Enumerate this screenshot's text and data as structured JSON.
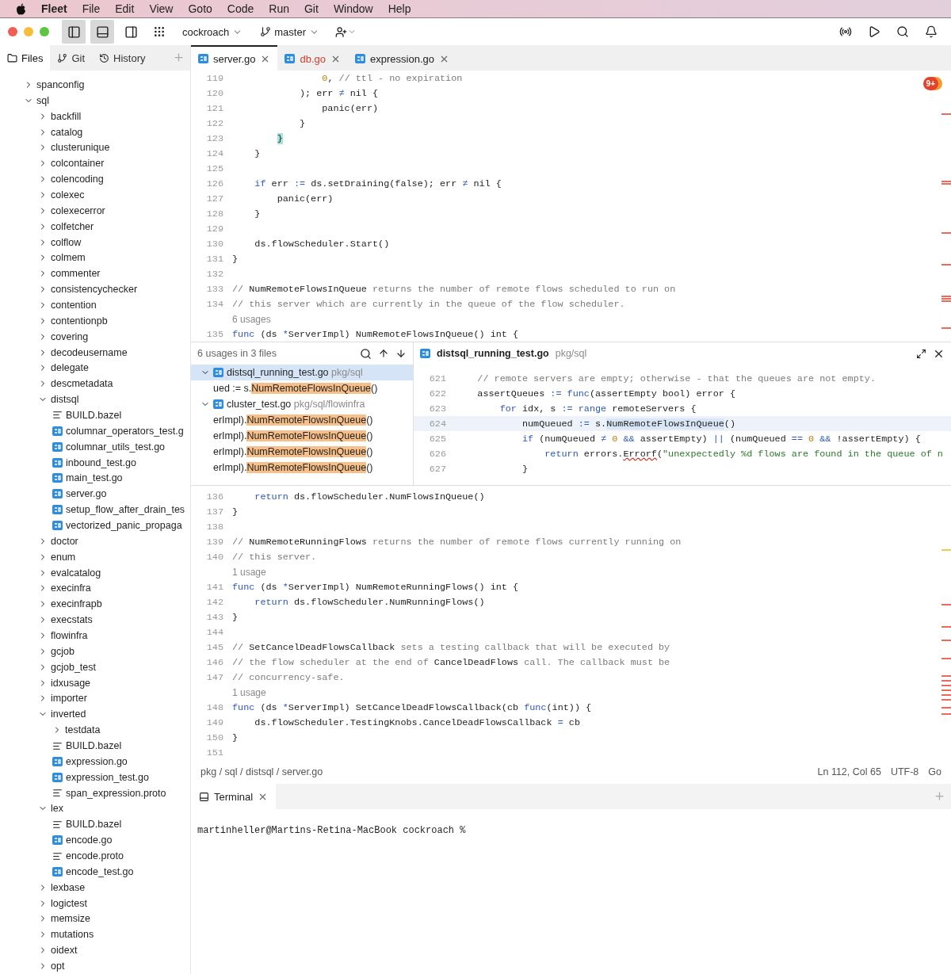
{
  "menu_bar": {
    "app": "Fleet",
    "items": [
      "File",
      "Edit",
      "View",
      "Goto",
      "Code",
      "Run",
      "Git",
      "Window",
      "Help"
    ]
  },
  "toolbar": {
    "panel_toggles": [
      {
        "selected": true
      },
      {
        "selected": true
      },
      {
        "selected": false
      }
    ],
    "workspace": "cockroach",
    "branch": "master"
  },
  "sidebar": {
    "tabs": [
      {
        "label": "Files",
        "selected": true
      },
      {
        "label": "Git",
        "selected": false
      },
      {
        "label": "History",
        "selected": false
      }
    ],
    "tree": [
      {
        "name": "spanconfig",
        "kind": "folder",
        "expanded": false
      },
      {
        "name": "sql",
        "kind": "folder",
        "expanded": true,
        "children": [
          {
            "name": "backfill",
            "kind": "folder",
            "expanded": false
          },
          {
            "name": "catalog",
            "kind": "folder",
            "expanded": false
          },
          {
            "name": "clusterunique",
            "kind": "folder",
            "expanded": false
          },
          {
            "name": "colcontainer",
            "kind": "folder",
            "expanded": false
          },
          {
            "name": "colencoding",
            "kind": "folder",
            "expanded": false
          },
          {
            "name": "colexec",
            "kind": "folder",
            "expanded": false
          },
          {
            "name": "colexecerror",
            "kind": "folder",
            "expanded": false
          },
          {
            "name": "colfetcher",
            "kind": "folder",
            "expanded": false
          },
          {
            "name": "colflow",
            "kind": "folder",
            "expanded": false
          },
          {
            "name": "colmem",
            "kind": "folder",
            "expanded": false
          },
          {
            "name": "commenter",
            "kind": "folder",
            "expanded": false
          },
          {
            "name": "consistencychecker",
            "kind": "folder",
            "expanded": false
          },
          {
            "name": "contention",
            "kind": "folder",
            "expanded": false
          },
          {
            "name": "contentionpb",
            "kind": "folder",
            "expanded": false
          },
          {
            "name": "covering",
            "kind": "folder",
            "expanded": false
          },
          {
            "name": "decodeusername",
            "kind": "folder",
            "expanded": false
          },
          {
            "name": "delegate",
            "kind": "folder",
            "expanded": false
          },
          {
            "name": "descmetadata",
            "kind": "folder",
            "expanded": false
          },
          {
            "name": "distsql",
            "kind": "folder",
            "expanded": true,
            "children": [
              {
                "name": "BUILD.bazel",
                "kind": "text"
              },
              {
                "name": "columnar_operators_test.g",
                "kind": "go"
              },
              {
                "name": "columnar_utils_test.go",
                "kind": "go"
              },
              {
                "name": "inbound_test.go",
                "kind": "go"
              },
              {
                "name": "main_test.go",
                "kind": "go"
              },
              {
                "name": "server.go",
                "kind": "go"
              },
              {
                "name": "setup_flow_after_drain_tes",
                "kind": "go"
              },
              {
                "name": "vectorized_panic_propaga",
                "kind": "go"
              }
            ]
          },
          {
            "name": "doctor",
            "kind": "folder",
            "expanded": false
          },
          {
            "name": "enum",
            "kind": "folder",
            "expanded": false
          },
          {
            "name": "evalcatalog",
            "kind": "folder",
            "expanded": false
          },
          {
            "name": "execinfra",
            "kind": "folder",
            "expanded": false
          },
          {
            "name": "execinfrapb",
            "kind": "folder",
            "expanded": false
          },
          {
            "name": "execstats",
            "kind": "folder",
            "expanded": false
          },
          {
            "name": "flowinfra",
            "kind": "folder",
            "expanded": false
          },
          {
            "name": "gcjob",
            "kind": "folder",
            "expanded": false
          },
          {
            "name": "gcjob_test",
            "kind": "folder",
            "expanded": false
          },
          {
            "name": "idxusage",
            "kind": "folder",
            "expanded": false
          },
          {
            "name": "importer",
            "kind": "folder",
            "expanded": false
          },
          {
            "name": "inverted",
            "kind": "folder",
            "expanded": true,
            "children": [
              {
                "name": "testdata",
                "kind": "folder",
                "expanded": false
              },
              {
                "name": "BUILD.bazel",
                "kind": "text"
              },
              {
                "name": "expression.go",
                "kind": "go"
              },
              {
                "name": "expression_test.go",
                "kind": "go"
              },
              {
                "name": "span_expression.proto",
                "kind": "text"
              }
            ]
          },
          {
            "name": "lex",
            "kind": "folder",
            "expanded": true,
            "children": [
              {
                "name": "BUILD.bazel",
                "kind": "text"
              },
              {
                "name": "encode.go",
                "kind": "go"
              },
              {
                "name": "encode.proto",
                "kind": "text"
              },
              {
                "name": "encode_test.go",
                "kind": "go"
              }
            ]
          },
          {
            "name": "lexbase",
            "kind": "folder",
            "expanded": false
          },
          {
            "name": "logictest",
            "kind": "folder",
            "expanded": false
          },
          {
            "name": "memsize",
            "kind": "folder",
            "expanded": false
          },
          {
            "name": "mutations",
            "kind": "folder",
            "expanded": false
          },
          {
            "name": "oidext",
            "kind": "folder",
            "expanded": false
          },
          {
            "name": "opt",
            "kind": "folder",
            "expanded": false
          }
        ]
      }
    ]
  },
  "editor_tabs": [
    {
      "name": "server.go",
      "selected": true,
      "has_errors": false
    },
    {
      "name": "db.go",
      "selected": false,
      "has_errors": true
    },
    {
      "name": "expression.go",
      "selected": false,
      "has_errors": false
    }
  ],
  "problems_badge": "9+",
  "top_pane": [
    {
      "kind": "code",
      "number": "119",
      "tokens": [
        {
          "kind": "number",
          "text": "                0"
        },
        {
          "kind": "text",
          "text": ", "
        },
        {
          "kind": "comment",
          "text": "// ttl - no expiration"
        }
      ]
    },
    {
      "kind": "code",
      "number": "120",
      "tokens": [
        {
          "kind": "text",
          "text": "            ); err "
        },
        {
          "kind": "operator",
          "text": "≠"
        },
        {
          "kind": "text",
          "text": " nil {"
        }
      ]
    },
    {
      "kind": "code",
      "number": "121",
      "tokens": [
        {
          "kind": "text",
          "text": "                panic(err)"
        }
      ]
    },
    {
      "kind": "code",
      "number": "122",
      "tokens": [
        {
          "kind": "text",
          "text": "            }"
        }
      ]
    },
    {
      "kind": "code",
      "number": "123",
      "tokens": [
        {
          "kind": "bracket_match",
          "text": "        }"
        }
      ]
    },
    {
      "kind": "code",
      "number": "124",
      "tokens": [
        {
          "kind": "text",
          "text": "    }"
        }
      ]
    },
    {
      "kind": "code",
      "number": "125"
    },
    {
      "kind": "code",
      "number": "126",
      "tokens": [
        {
          "kind": "keyword",
          "text": "    if"
        },
        {
          "kind": "text",
          "text": " err "
        },
        {
          "kind": "operator",
          "text": ":="
        },
        {
          "kind": "text",
          "text": " ds.setDraining(false); err "
        },
        {
          "kind": "operator",
          "text": "≠"
        },
        {
          "kind": "text",
          "text": " nil {"
        }
      ]
    },
    {
      "kind": "code",
      "number": "127",
      "tokens": [
        {
          "kind": "text",
          "text": "        panic(err)"
        }
      ]
    },
    {
      "kind": "code",
      "number": "128",
      "tokens": [
        {
          "kind": "text",
          "text": "    }"
        }
      ]
    },
    {
      "kind": "code",
      "number": "129"
    },
    {
      "kind": "code",
      "number": "130",
      "tokens": [
        {
          "kind": "text",
          "text": "    ds.flowScheduler.Start()"
        }
      ]
    },
    {
      "kind": "code",
      "number": "131",
      "tokens": [
        {
          "kind": "text",
          "text": "}"
        }
      ]
    },
    {
      "kind": "code",
      "number": "132"
    },
    {
      "kind": "code",
      "number": "133",
      "tokens": [
        {
          "kind": "comment",
          "text": "// "
        },
        {
          "kind": "doc_ref",
          "text": "NumRemoteFlowsInQueue"
        },
        {
          "kind": "comment",
          "text": " returns the number of remote flows scheduled to run on"
        }
      ]
    },
    {
      "kind": "code",
      "number": "134",
      "tokens": [
        {
          "kind": "comment",
          "text": "// this server which are currently in the queue of the flow scheduler."
        }
      ]
    },
    {
      "kind": "hint",
      "text": "6 usages"
    },
    {
      "kind": "code",
      "number": "135",
      "tokens": [
        {
          "kind": "keyword",
          "text": "func"
        },
        {
          "kind": "text",
          "text": " (ds "
        },
        {
          "kind": "operator",
          "text": "*"
        },
        {
          "kind": "text",
          "text": "ServerImpl) NumRemoteFlowsInQueue() int {"
        }
      ]
    }
  ],
  "usages": {
    "title": "6 usages in 3 files",
    "rows": [
      {
        "kind": "file",
        "expanded": true,
        "selected": true,
        "name": "distsql_running_test.go",
        "path": "pkg/sql"
      },
      {
        "kind": "match",
        "prefix": "ued := s.",
        "match": "NumRemoteFlowsInQueue",
        "suffix": "()"
      },
      {
        "kind": "file",
        "expanded": true,
        "selected": false,
        "name": "cluster_test.go",
        "path": "pkg/sql/flowinfra"
      },
      {
        "kind": "match",
        "prefix": "erImpl).",
        "match": "NumRemoteFlowsInQueue",
        "suffix": "()"
      },
      {
        "kind": "match",
        "prefix": "erImpl).",
        "match": "NumRemoteFlowsInQueue",
        "suffix": "()"
      },
      {
        "kind": "match",
        "prefix": "erImpl).",
        "match": "NumRemoteFlowsInQueue",
        "suffix": "()"
      },
      {
        "kind": "match",
        "prefix": "erImpl).",
        "match": "NumRemoteFlowsInQueue",
        "suffix": "()"
      }
    ],
    "preview": {
      "file": "distsql_running_test.go",
      "path": "pkg/sql",
      "lines": [
        {
          "number": "621",
          "current": false,
          "tokens": [
            {
              "kind": "comment",
              "text": "    // remote servers are empty; otherwise - that the queues are not empty."
            }
          ]
        },
        {
          "number": "622",
          "current": false,
          "tokens": [
            {
              "kind": "text",
              "text": "    assertQueues "
            },
            {
              "kind": "operator",
              "text": ":="
            },
            {
              "kind": "keyword",
              "text": " func"
            },
            {
              "kind": "text",
              "text": "(assertEmpty bool) error {"
            }
          ]
        },
        {
          "number": "623",
          "current": false,
          "tokens": [
            {
              "kind": "keyword",
              "text": "        for"
            },
            {
              "kind": "text",
              "text": " idx, s "
            },
            {
              "kind": "operator",
              "text": ":="
            },
            {
              "kind": "keyword",
              "text": " range"
            },
            {
              "kind": "text",
              "text": " remoteServers {"
            }
          ]
        },
        {
          "number": "624",
          "current": true,
          "tokens": [
            {
              "kind": "text",
              "text": "            numQueued "
            },
            {
              "kind": "operator",
              "text": ":="
            },
            {
              "kind": "text",
              "text": " s."
            },
            {
              "kind": "usage",
              "text": "NumRemoteFlowsInQueue"
            },
            {
              "kind": "text",
              "text": "()"
            }
          ]
        },
        {
          "number": "625",
          "current": false,
          "tokens": [
            {
              "kind": "keyword",
              "text": "            if"
            },
            {
              "kind": "text",
              "text": " (numQueued "
            },
            {
              "kind": "operator",
              "text": "≠"
            },
            {
              "kind": "number",
              "text": " 0"
            },
            {
              "kind": "operator",
              "text": " &&"
            },
            {
              "kind": "text",
              "text": " assertEmpty) "
            },
            {
              "kind": "operator",
              "text": "||"
            },
            {
              "kind": "text",
              "text": " (numQueued "
            },
            {
              "kind": "operator",
              "text": "=="
            },
            {
              "kind": "number",
              "text": " 0"
            },
            {
              "kind": "operator",
              "text": " &&"
            },
            {
              "kind": "text",
              "text": " !assertEmpty) {"
            }
          ]
        },
        {
          "number": "626",
          "current": false,
          "tokens": [
            {
              "kind": "keyword",
              "text": "                return"
            },
            {
              "kind": "text",
              "text": " errors."
            },
            {
              "kind": "error",
              "text": "Errorf"
            },
            {
              "kind": "text",
              "text": "("
            },
            {
              "kind": "string",
              "text": "\"unexpectedly %d flows are found in the queue of n"
            }
          ]
        },
        {
          "number": "627",
          "current": false,
          "tokens": [
            {
              "kind": "text",
              "text": "            }"
            }
          ]
        }
      ]
    }
  },
  "bottom_pane": [
    {
      "kind": "code",
      "number": "136",
      "tokens": [
        {
          "kind": "keyword",
          "text": "    return"
        },
        {
          "kind": "text",
          "text": " ds.flowScheduler.NumFlowsInQueue()"
        }
      ]
    },
    {
      "kind": "code",
      "number": "137",
      "tokens": [
        {
          "kind": "text",
          "text": "}"
        }
      ]
    },
    {
      "kind": "code",
      "number": "138"
    },
    {
      "kind": "code",
      "number": "139",
      "tokens": [
        {
          "kind": "comment",
          "text": "// "
        },
        {
          "kind": "doc_ref",
          "text": "NumRemoteRunningFlows"
        },
        {
          "kind": "comment",
          "text": " returns the number of remote flows currently running on"
        }
      ]
    },
    {
      "kind": "code",
      "number": "140",
      "tokens": [
        {
          "kind": "comment",
          "text": "// this server."
        }
      ]
    },
    {
      "kind": "hint",
      "text": "1 usage"
    },
    {
      "kind": "code",
      "number": "141",
      "tokens": [
        {
          "kind": "keyword",
          "text": "func"
        },
        {
          "kind": "text",
          "text": " (ds "
        },
        {
          "kind": "operator",
          "text": "*"
        },
        {
          "kind": "text",
          "text": "ServerImpl) NumRemoteRunningFlows() int {"
        }
      ]
    },
    {
      "kind": "code",
      "number": "142",
      "tokens": [
        {
          "kind": "keyword",
          "text": "    return"
        },
        {
          "kind": "text",
          "text": " ds.flowScheduler.NumRunningFlows()"
        }
      ]
    },
    {
      "kind": "code",
      "number": "143",
      "tokens": [
        {
          "kind": "text",
          "text": "}"
        }
      ]
    },
    {
      "kind": "code",
      "number": "144"
    },
    {
      "kind": "code",
      "number": "145",
      "tokens": [
        {
          "kind": "comment",
          "text": "// "
        },
        {
          "kind": "doc_ref",
          "text": "SetCancelDeadFlowsCallback"
        },
        {
          "kind": "comment",
          "text": " sets a testing callback that will be executed by"
        }
      ]
    },
    {
      "kind": "code",
      "number": "146",
      "tokens": [
        {
          "kind": "comment",
          "text": "// the flow scheduler at the end of "
        },
        {
          "kind": "doc_ref",
          "text": "CancelDeadFlows"
        },
        {
          "kind": "comment",
          "text": " call. The callback must be"
        }
      ]
    },
    {
      "kind": "code",
      "number": "147",
      "tokens": [
        {
          "kind": "comment",
          "text": "// concurrency-safe."
        }
      ]
    },
    {
      "kind": "hint",
      "text": "1 usage"
    },
    {
      "kind": "code",
      "number": "148",
      "tokens": [
        {
          "kind": "keyword",
          "text": "func"
        },
        {
          "kind": "text",
          "text": " (ds "
        },
        {
          "kind": "operator",
          "text": "*"
        },
        {
          "kind": "text",
          "text": "ServerImpl) SetCancelDeadFlowsCallback(cb "
        },
        {
          "kind": "keyword",
          "text": "func"
        },
        {
          "kind": "text",
          "text": "(int)) {"
        }
      ]
    },
    {
      "kind": "code",
      "number": "149",
      "tokens": [
        {
          "kind": "text",
          "text": "    ds.flowScheduler.TestingKnobs.CancelDeadFlowsCallback "
        },
        {
          "kind": "operator",
          "text": "="
        },
        {
          "kind": "text",
          "text": " cb"
        }
      ]
    },
    {
      "kind": "code",
      "number": "150",
      "tokens": [
        {
          "kind": "text",
          "text": "}"
        }
      ]
    },
    {
      "kind": "code",
      "number": "151"
    }
  ],
  "status_bar": {
    "breadcrumb": "pkg / sql / distsql / server.go",
    "position": "Ln 112, Col 65",
    "encoding": "UTF-8",
    "language": "Go"
  },
  "terminal": {
    "tabs": [
      {
        "label": "Terminal",
        "selected": true
      }
    ],
    "prompt": "martinheller@Martins-Retina-MacBook cockroach %"
  }
}
